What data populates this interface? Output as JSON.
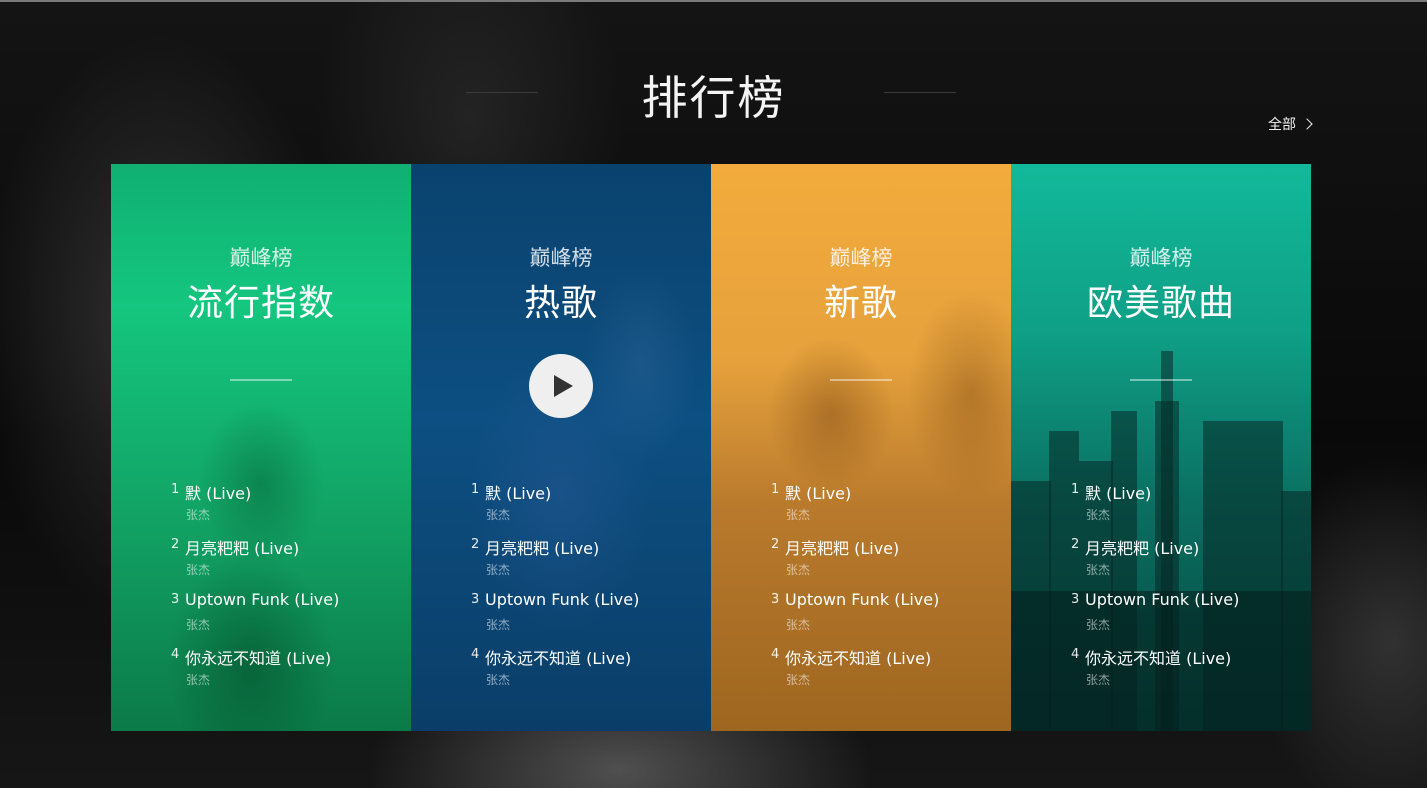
{
  "section": {
    "title": "排行榜",
    "all_label": "全部"
  },
  "cards": [
    {
      "subtitle": "巅峰榜",
      "name": "流行指数",
      "tracks": [
        {
          "num": "1",
          "title": "默 (Live)",
          "artist": "张杰"
        },
        {
          "num": "2",
          "title": "月亮粑粑 (Live)",
          "artist": "张杰"
        },
        {
          "num": "3",
          "title": "Uptown Funk (Live)",
          "artist": "张杰"
        },
        {
          "num": "4",
          "title": "你永远不知道 (Live)",
          "artist": "张杰"
        }
      ]
    },
    {
      "subtitle": "巅峰榜",
      "name": "热歌",
      "tracks": [
        {
          "num": "1",
          "title": "默 (Live)",
          "artist": "张杰"
        },
        {
          "num": "2",
          "title": "月亮粑粑 (Live)",
          "artist": "张杰"
        },
        {
          "num": "3",
          "title": "Uptown Funk (Live)",
          "artist": "张杰"
        },
        {
          "num": "4",
          "title": "你永远不知道 (Live)",
          "artist": "张杰"
        }
      ]
    },
    {
      "subtitle": "巅峰榜",
      "name": "新歌",
      "tracks": [
        {
          "num": "1",
          "title": "默 (Live)",
          "artist": "张杰"
        },
        {
          "num": "2",
          "title": "月亮粑粑 (Live)",
          "artist": "张杰"
        },
        {
          "num": "3",
          "title": "Uptown Funk (Live)",
          "artist": "张杰"
        },
        {
          "num": "4",
          "title": "你永远不知道 (Live)",
          "artist": "张杰"
        }
      ]
    },
    {
      "subtitle": "巅峰榜",
      "name": "欧美歌曲",
      "tracks": [
        {
          "num": "1",
          "title": "默 (Live)",
          "artist": "张杰"
        },
        {
          "num": "2",
          "title": "月亮粑粑 (Live)",
          "artist": "张杰"
        },
        {
          "num": "3",
          "title": "Uptown Funk (Live)",
          "artist": "张杰"
        },
        {
          "num": "4",
          "title": "你永远不知道 (Live)",
          "artist": "张杰"
        }
      ]
    }
  ],
  "colors": {
    "card_1": "#12b876",
    "card_2": "#0b4777",
    "card_3": "#eba53c",
    "card_4": "#0f9f86"
  },
  "icons": {
    "all_link": "chevron-right-icon",
    "play": "play-icon"
  }
}
